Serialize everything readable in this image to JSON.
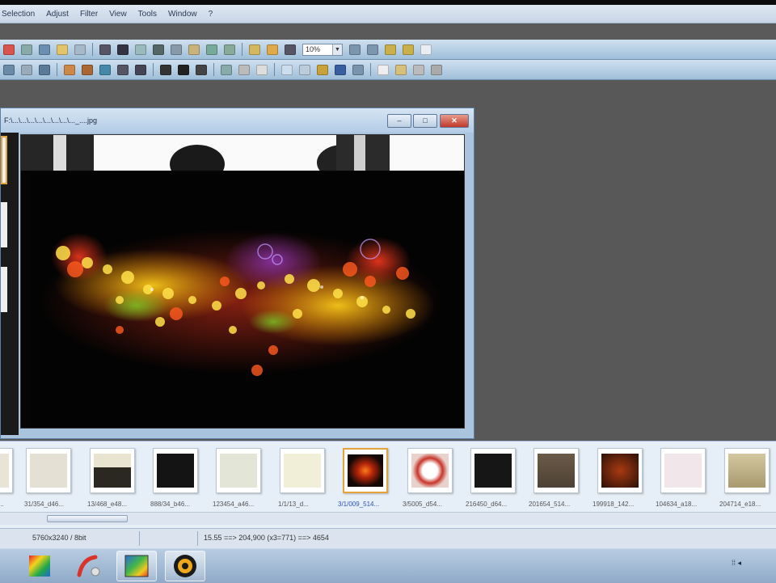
{
  "menu": {
    "items": [
      "Selection",
      "Adjust",
      "Filter",
      "View",
      "Tools",
      "Window",
      "?"
    ]
  },
  "toolbar": {
    "zoom_value": "10%",
    "zoom_dropdown": "▼"
  },
  "image_window": {
    "title": "F:\\...\\...\\...\\...\\...\\...\\...\\..._....jpg",
    "minimize": "–",
    "maximize": "□",
    "close": "✕"
  },
  "thumbnails": [
    {
      "caption": "...",
      "color": "#e9e4d8"
    },
    {
      "caption": "31/354_d46...",
      "color": "#e4e0d3"
    },
    {
      "caption": "13/468_e48...",
      "color": "#2a2820"
    },
    {
      "caption": "888/34_b46...",
      "color": "#141414"
    },
    {
      "caption": "123454_a46...",
      "color": "#e3e6d7"
    },
    {
      "caption": "1/1/13_d...",
      "color": "#f2efd8"
    },
    {
      "caption": "3/1/009_514...",
      "color": "#120806"
    },
    {
      "caption": "3/5005_d54...",
      "color": "#e9d2cc"
    },
    {
      "caption": "216450_d64...",
      "color": "#161616"
    },
    {
      "caption": "201654_514...",
      "color": "#5b4e40"
    },
    {
      "caption": "199918_142...",
      "color": "#2b1008"
    },
    {
      "caption": "104634_a18...",
      "color": "#f1e6ea"
    },
    {
      "caption": "204714_e18...",
      "color": "#bfb28b"
    }
  ],
  "status": {
    "dimensions": "5760x3240 / 8bit",
    "position": "15.55 ==> 204,900 (x3=771) ==> 4654"
  },
  "taskbar": {
    "apps": [
      "color-wheel-app",
      "paint-app",
      "image-viewer-app",
      "media-player-app"
    ],
    "tray": "⁞⁞ ◂"
  }
}
